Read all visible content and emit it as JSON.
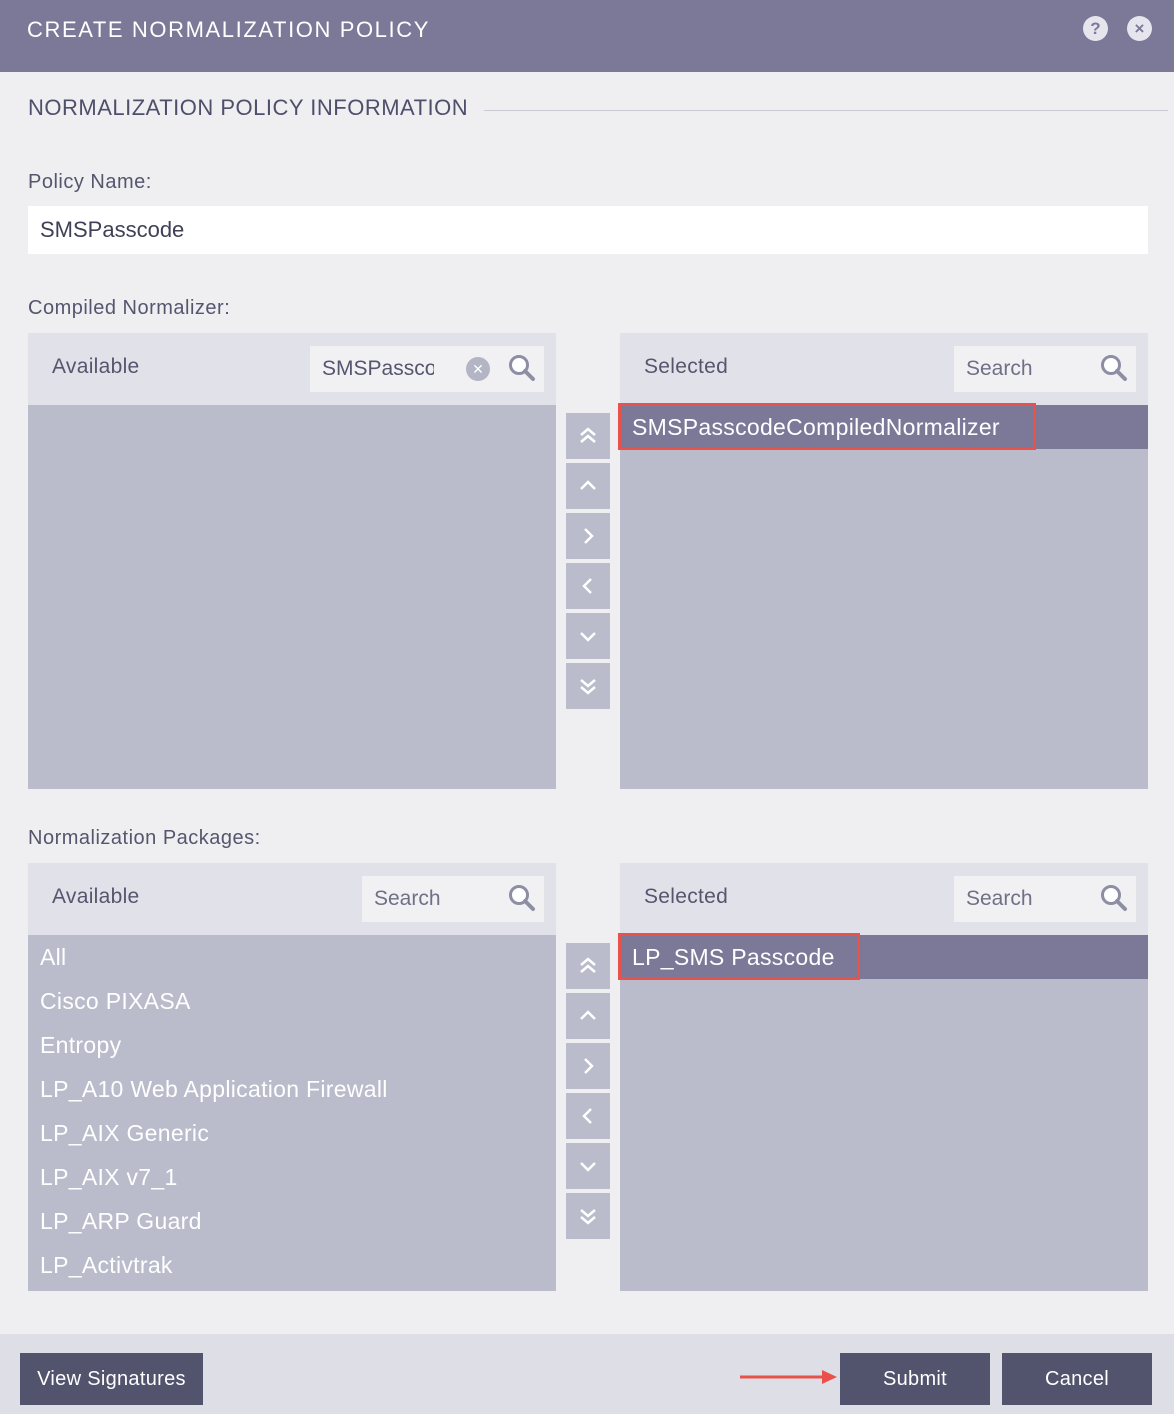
{
  "dialog": {
    "title": "CREATE NORMALIZATION POLICY",
    "help_icon": "?",
    "close_icon": "×"
  },
  "section": {
    "title": "NORMALIZATION POLICY INFORMATION"
  },
  "policy_name": {
    "label": "Policy Name:",
    "value": "SMSPasscode"
  },
  "compiled_normalizer": {
    "label": "Compiled Normalizer:",
    "available": {
      "label": "Available",
      "search_value": "SMSPasscode",
      "items": []
    },
    "selected": {
      "label": "Selected",
      "search_placeholder": "Search",
      "items": [
        "SMSPasscodeCompiledNormalizer"
      ]
    }
  },
  "normalization_packages": {
    "label": "Normalization Packages:",
    "available": {
      "label": "Available",
      "search_placeholder": "Search",
      "items": [
        "All",
        "Cisco PIXASA",
        "Entropy",
        "LP_A10 Web Application Firewall",
        "LP_AIX Generic",
        "LP_AIX v7_1",
        "LP_ARP Guard",
        "LP_Activtrak"
      ]
    },
    "selected": {
      "label": "Selected",
      "search_placeholder": "Search",
      "items": [
        "LP_SMS Passcode"
      ]
    }
  },
  "footer": {
    "view_signatures": "View Signatures",
    "submit": "Submit",
    "cancel": "Cancel"
  },
  "colors": {
    "header": "#7b7898",
    "highlight": "#e8524a",
    "button": "#52536d",
    "list_bg": "#babbcb"
  }
}
